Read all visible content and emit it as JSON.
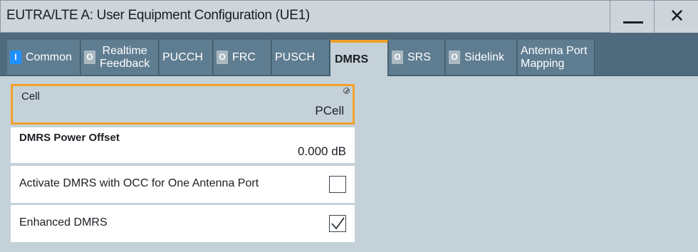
{
  "window": {
    "title": "EUTRA/LTE A: User Equipment Configuration (UE1)",
    "minimize_icon": "minimize-icon",
    "close_icon": "close-icon",
    "close_glyph": "✕"
  },
  "tabs": [
    {
      "label": "Common",
      "led": "I",
      "led_state": "on"
    },
    {
      "label_line1": "Realtime",
      "label_line2": "Feedback",
      "led": "O",
      "led_state": "off"
    },
    {
      "label": "PUCCH"
    },
    {
      "label": "FRC",
      "led": "O",
      "led_state": "off"
    },
    {
      "label": "PUSCH"
    },
    {
      "label": "DMRS",
      "active": true
    },
    {
      "label": "SRS",
      "led": "O",
      "led_state": "off"
    },
    {
      "label": "Sidelink",
      "led": "O",
      "led_state": "off"
    },
    {
      "label_line1": "Antenna Port",
      "label_line2": "Mapping"
    }
  ],
  "cell": {
    "label": "Cell",
    "value": "PCell"
  },
  "dmrs_power_offset": {
    "label": "DMRS Power Offset",
    "value": "0.000 dB"
  },
  "occ": {
    "label": "Activate DMRS with OCC for One Antenna Port",
    "checked": false
  },
  "enhanced_dmrs": {
    "label": "Enhanced DMRS",
    "checked": true
  },
  "colors": {
    "accent": "#f2a02a",
    "tabbar": "#4f6a7d",
    "led_on": "#1e90ff",
    "background": "#c5d1d9"
  }
}
